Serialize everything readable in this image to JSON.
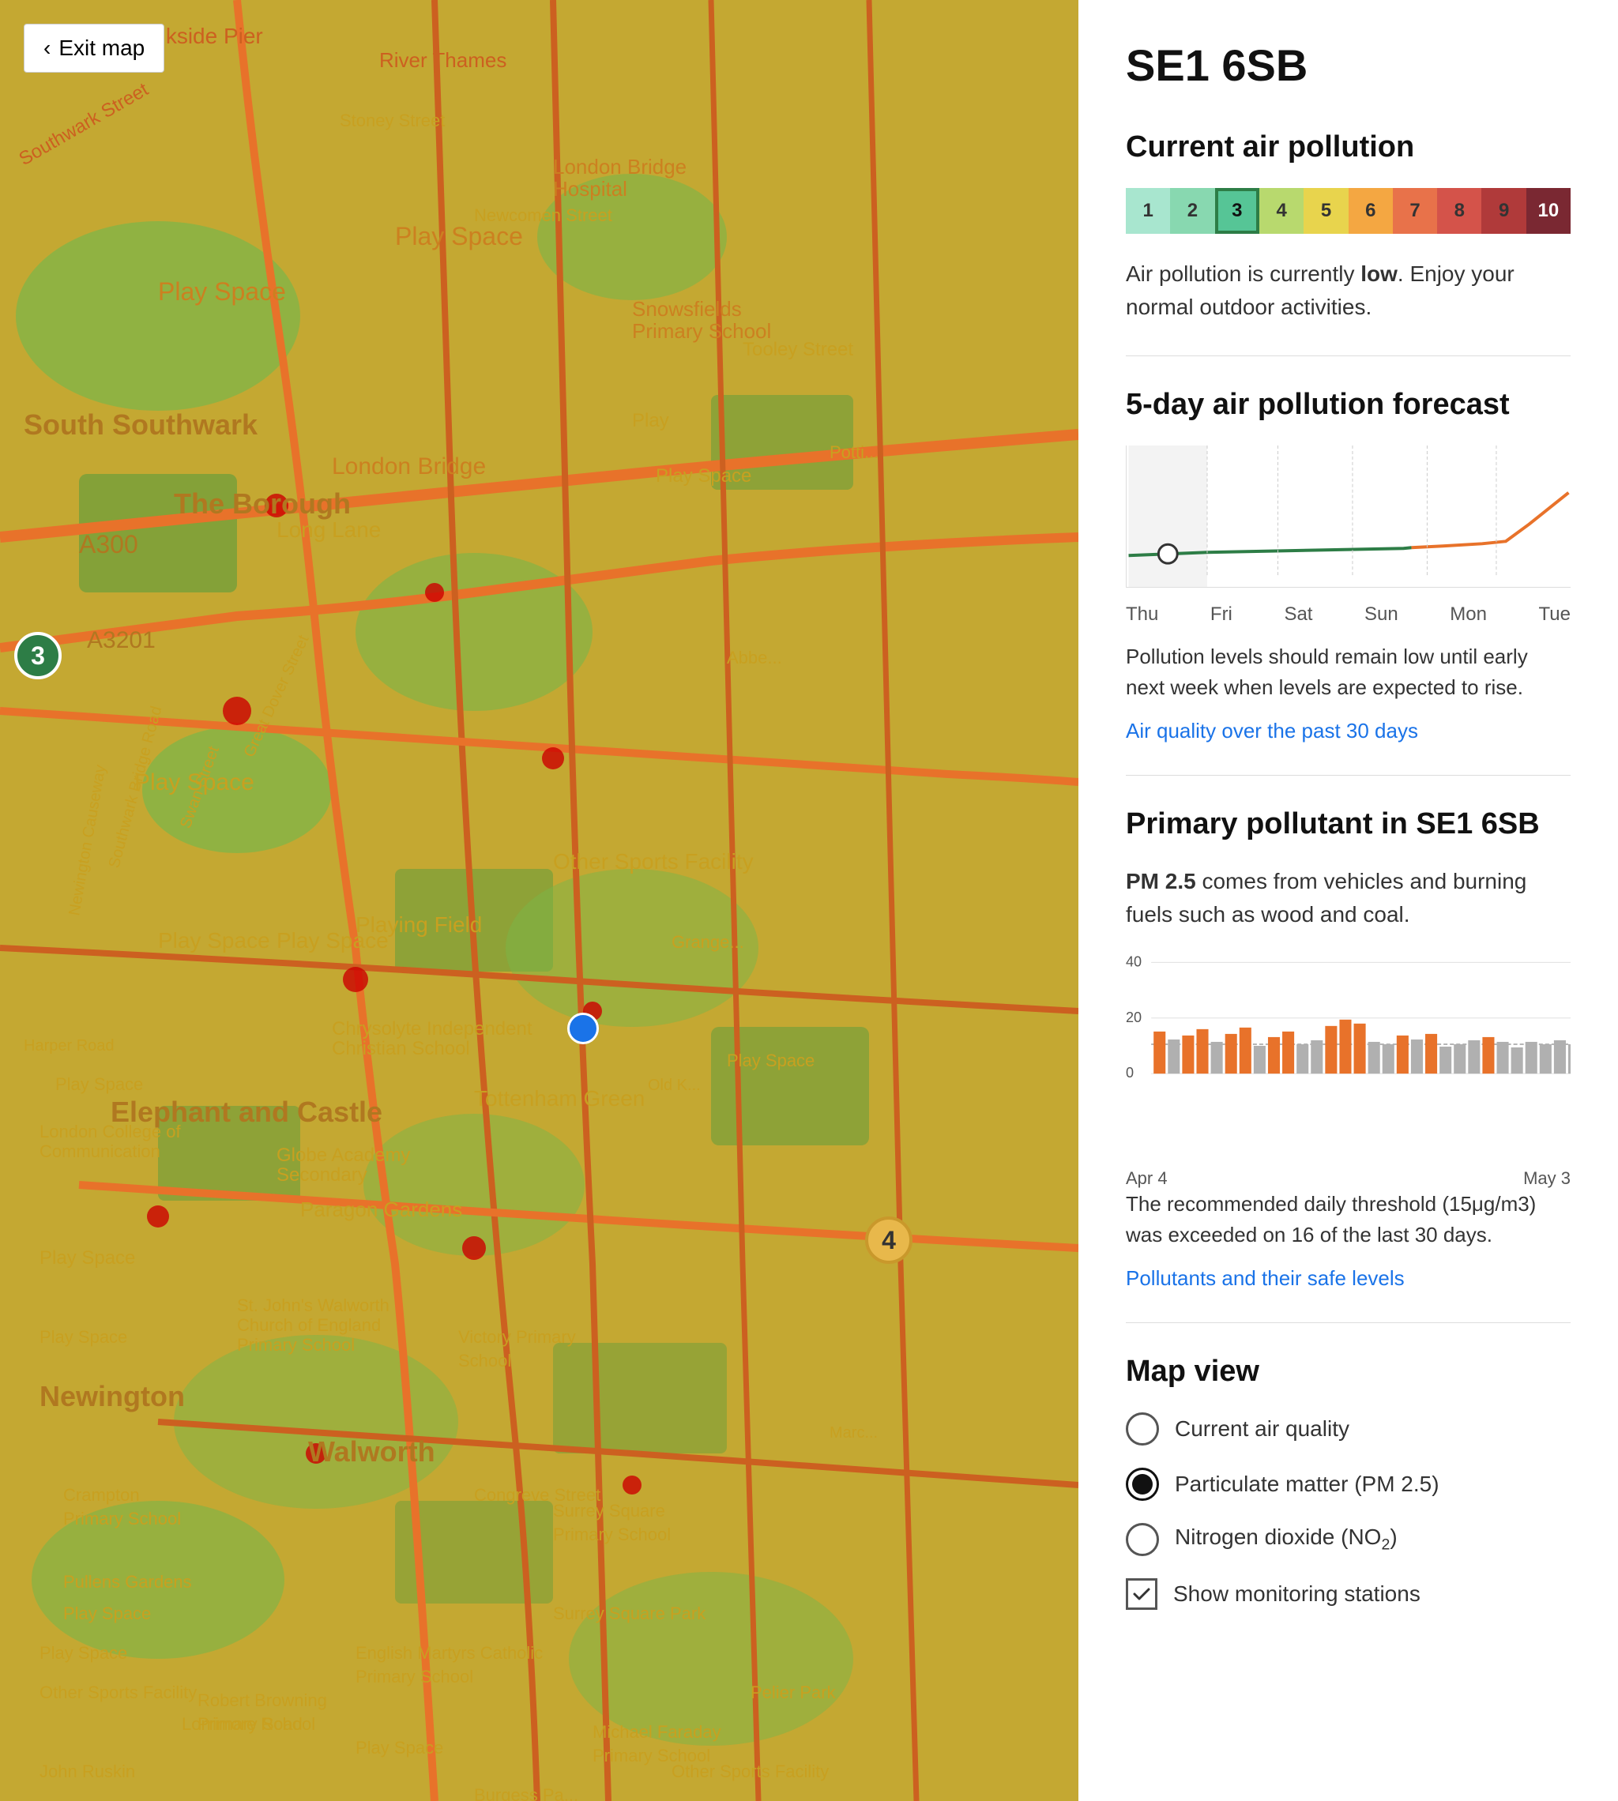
{
  "map": {
    "exit_button": "Exit map",
    "markers": [
      {
        "id": "marker-3-left",
        "value": "3",
        "type": "green",
        "top": "810",
        "left": "22"
      },
      {
        "id": "marker-4",
        "value": "4",
        "type": "yellow",
        "top": "1540",
        "left": "1090"
      },
      {
        "id": "marker-blue",
        "value": "",
        "type": "blue",
        "top": "1295",
        "left": "720"
      }
    ]
  },
  "panel": {
    "location": "SE1 6SB",
    "current_pollution": {
      "title": "Current air pollution",
      "aqi_value": 3,
      "aqi_cells": [
        {
          "value": "1"
        },
        {
          "value": "2"
        },
        {
          "value": "3"
        },
        {
          "value": "4"
        },
        {
          "value": "5"
        },
        {
          "value": "6"
        },
        {
          "value": "7"
        },
        {
          "value": "8"
        },
        {
          "value": "9"
        },
        {
          "value": "10"
        }
      ],
      "description_prefix": "Air pollution is currently ",
      "description_level": "low",
      "description_suffix": ". Enjoy your normal outdoor activities."
    },
    "forecast": {
      "title": "5-day air pollution forecast",
      "days": [
        "Thu",
        "Fri",
        "Sat",
        "Sun",
        "Mon",
        "Tue"
      ],
      "description": "Pollution levels should remain low until early next week when levels are expected to rise.",
      "past_link": "Air quality over the past 30 days"
    },
    "primary_pollutant": {
      "title": "Primary pollutant in SE1 6SB",
      "pollutant_name": "PM 2.5",
      "pollutant_desc": " comes from vehicles and burning fuels such as wood and coal.",
      "chart_y_labels": [
        "40",
        "20",
        "0"
      ],
      "chart_x_start": "Apr 4",
      "chart_x_end": "May 3",
      "threshold_text": "The recommended daily threshold (15μg/m3) was exceeded on 16 of the last 30 days.",
      "safe_levels_link": "Pollutants and their safe levels",
      "bar_data": [
        {
          "orange": true,
          "height": 55
        },
        {
          "orange": false,
          "height": 45
        },
        {
          "orange": true,
          "height": 50
        },
        {
          "orange": true,
          "height": 58
        },
        {
          "orange": false,
          "height": 40
        },
        {
          "orange": true,
          "height": 52
        },
        {
          "orange": true,
          "height": 60
        },
        {
          "orange": false,
          "height": 35
        },
        {
          "orange": true,
          "height": 48
        },
        {
          "orange": true,
          "height": 55
        },
        {
          "orange": false,
          "height": 38
        },
        {
          "orange": false,
          "height": 42
        },
        {
          "orange": true,
          "height": 62
        },
        {
          "orange": true,
          "height": 70
        },
        {
          "orange": true,
          "height": 65
        },
        {
          "orange": false,
          "height": 40
        },
        {
          "orange": false,
          "height": 38
        },
        {
          "orange": true,
          "height": 50
        },
        {
          "orange": false,
          "height": 45
        },
        {
          "orange": true,
          "height": 52
        },
        {
          "orange": false,
          "height": 35
        },
        {
          "orange": false,
          "height": 38
        },
        {
          "orange": false,
          "height": 42
        },
        {
          "orange": true,
          "height": 48
        },
        {
          "orange": false,
          "height": 40
        },
        {
          "orange": false,
          "height": 36
        },
        {
          "orange": false,
          "height": 40
        },
        {
          "orange": false,
          "height": 38
        },
        {
          "orange": false,
          "height": 42
        },
        {
          "orange": false,
          "height": 38
        }
      ]
    },
    "map_view": {
      "title": "Map view",
      "options": [
        {
          "label": "Current air quality",
          "selected": false,
          "type": "radio"
        },
        {
          "label": "Particulate matter (PM 2.5)",
          "selected": true,
          "type": "radio"
        },
        {
          "label": "Nitrogen dioxide (NO₂)",
          "selected": false,
          "type": "radio"
        }
      ],
      "checkbox": {
        "label": "Show monitoring stations",
        "checked": true
      }
    }
  }
}
